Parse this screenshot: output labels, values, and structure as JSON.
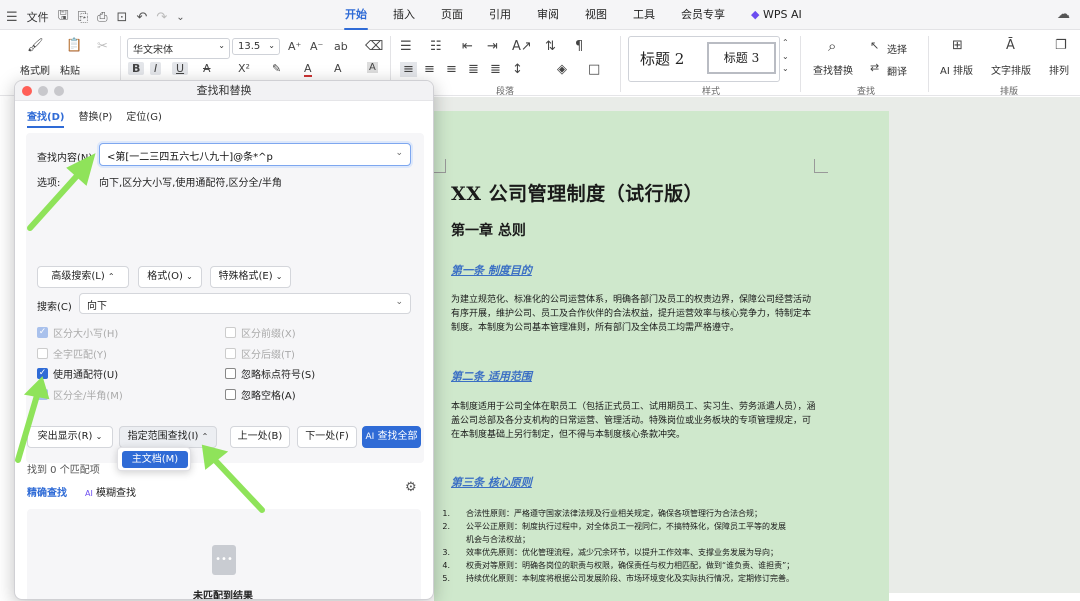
{
  "titlebar": {
    "file_label": "文件",
    "tabs": [
      "开始",
      "插入",
      "页面",
      "引用",
      "审阅",
      "视图",
      "工具",
      "会员专享",
      "WPS AI"
    ],
    "active_tab": "开始"
  },
  "ribbon": {
    "format_painter": "格式刷",
    "paste": "粘贴",
    "font_name": "华文宋体",
    "font_size": "13.5",
    "style_1": "标题 2",
    "style_2": "标题 3",
    "find_replace": "查找替换",
    "select": "选择",
    "translate": "翻译",
    "ai_layout": "AI 排版",
    "text_layout": "文字排版",
    "arrange": "排列",
    "group_paragraph": "段落",
    "group_style": "样式",
    "group_find": "查找",
    "group_layout": "排版"
  },
  "dialog": {
    "title": "查找和替换",
    "tabs": [
      "查找(D)",
      "替换(P)",
      "定位(G)"
    ],
    "find_label": "查找内容(N)",
    "find_value": "<第[一二三四五六七八九十]@条*^p",
    "options_label": "选项:",
    "options_value": "向下,区分大小写,使用通配符,区分全/半角",
    "advanced_search": "高级搜索(L)",
    "format": "格式(O)",
    "special_format": "特殊格式(E)",
    "search_label": "搜索(C)",
    "search_value": "向下",
    "checkboxes": {
      "match_case": "区分大小写(H)",
      "whole_word": "全字匹配(Y)",
      "use_wildcards": "使用通配符(U)",
      "full_half": "区分全/半角(M)",
      "prefix": "区分前缀(X)",
      "suffix": "区分后缀(T)",
      "ignore_punct": "忽略标点符号(S)",
      "ignore_space": "忽略空格(A)"
    },
    "highlight": "突出显示(R)",
    "find_in_range": "指定范围查找(I)",
    "prev": "上一处(B)",
    "next": "下一处(F)",
    "find_all": "查找全部",
    "ai_label": "AI",
    "range_option": "主文档(M)",
    "found_text": "找到 0 个匹配项",
    "precise_search": "精确查找",
    "fuzzy_search": "模糊查找",
    "no_result": "未匹配到结果"
  },
  "document": {
    "title": "XX 公司管理制度（试行版）",
    "chapter": "第一章 总则",
    "article1": "第一条 制度目的",
    "para1": "为建立规范化、标准化的公司运营体系，明确各部门及员工的权责边界，保障公司经营活动有序开展，维护公司、员工及合作伙伴的合法权益，提升运营效率与核心竞争力，特制定本制度。本制度为公司基本管理准则，所有部门及全体员工均需严格遵守。",
    "article2": "第二条 适用范围",
    "para2": "本制度适用于公司全体在职员工（包括正式员工、试用期员工、实习生、劳务派遣人员），涵盖公司总部及各分支机构的日常运营、管理活动。特殊岗位或业务板块的专项管理规定，可在本制度基础上另行制定，但不得与本制度核心条款冲突。",
    "article3": "第三条 核心原则",
    "list": [
      {
        "n": "1.",
        "t": "合法性原则：严格遵守国家法律法规及行业相关规定，确保各项管理行为合法合规；"
      },
      {
        "n": "2.",
        "t": "公平公正原则：制度执行过程中，对全体员工一视同仁，不搞特殊化，保障员工平等的发展"
      },
      {
        "n": "",
        "t": "机会与合法权益；"
      },
      {
        "n": "3.",
        "t": "效率优先原则：优化管理流程，减少冗余环节，以提升工作效率、支撑业务发展为导向；"
      },
      {
        "n": "4.",
        "t": "权责对等原则：明确各岗位的职责与权限，确保责任与权力相匹配，做到“谁负责、谁担责”；"
      },
      {
        "n": "5.",
        "t": "持续优化原则：本制度将根据公司发展阶段、市场环境变化及实际执行情况，定期修订完善。"
      }
    ]
  }
}
